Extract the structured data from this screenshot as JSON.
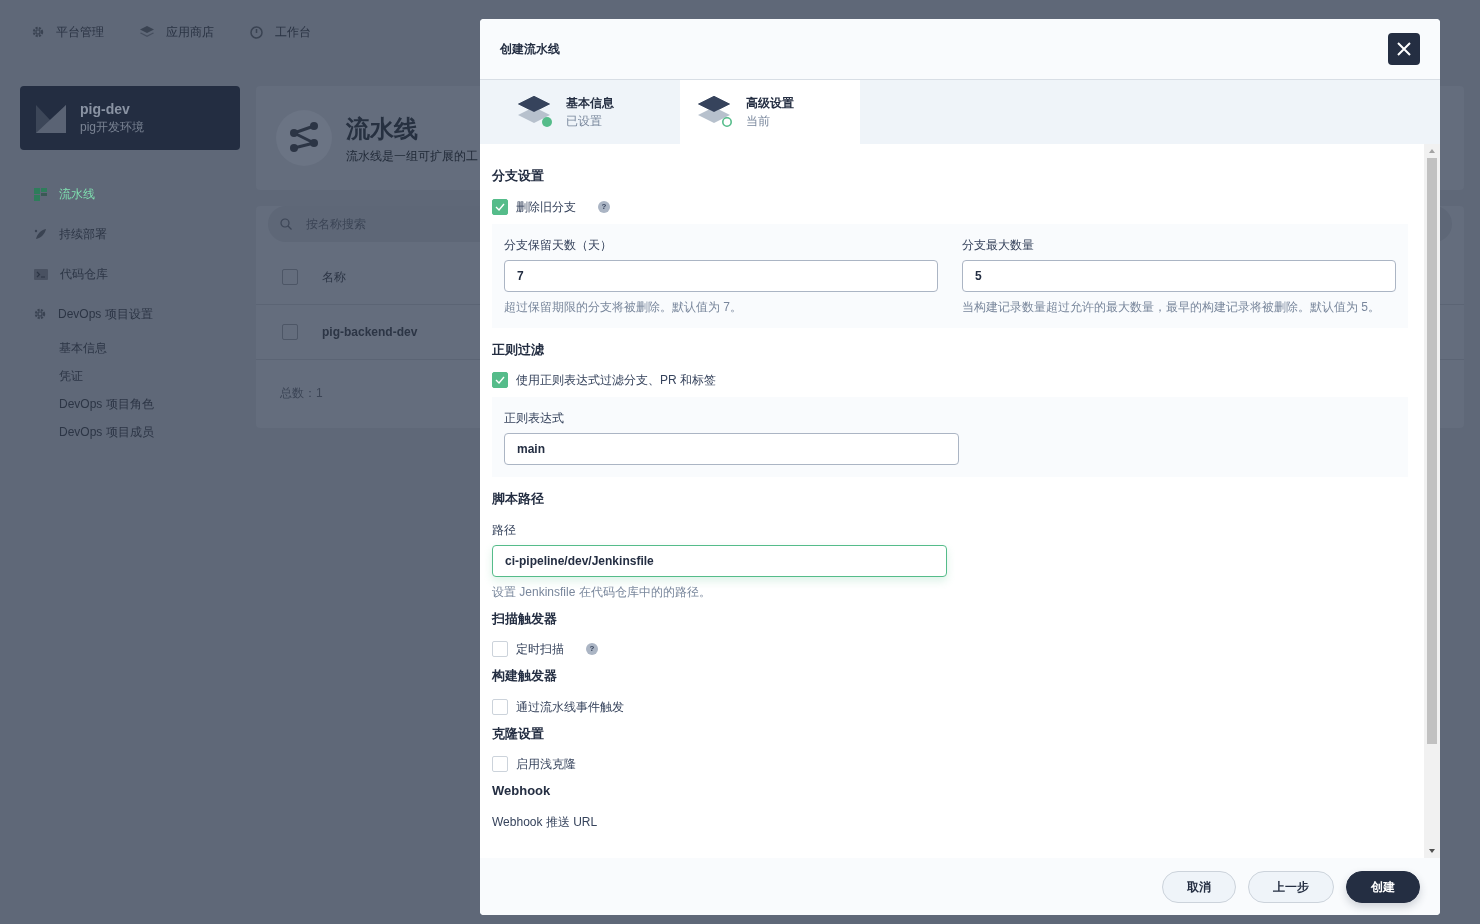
{
  "top_nav": [
    {
      "label": "平台管理"
    },
    {
      "label": "应用商店"
    },
    {
      "label": "工作台"
    }
  ],
  "project": {
    "name": "pig-dev",
    "description": "pig开发环境"
  },
  "sidebar": {
    "items": [
      {
        "label": "流水线",
        "selected": true
      },
      {
        "label": "持续部署",
        "selected": false
      },
      {
        "label": "代码仓库",
        "selected": false
      },
      {
        "label": "DevOps 项目设置",
        "selected": false,
        "children": [
          {
            "label": "基本信息",
            "selected": false
          },
          {
            "label": "凭证",
            "selected": false
          },
          {
            "label": "DevOps 项目角色",
            "selected": false
          },
          {
            "label": "DevOps 项目成员",
            "selected": false
          }
        ]
      }
    ]
  },
  "page_header": {
    "title": "流水线",
    "description": "流水线是一组可扩展的工"
  },
  "table": {
    "search_placeholder": "按名称搜索",
    "columns": [
      "名称"
    ],
    "rows": [
      {
        "name": "pig-backend-dev",
        "checked": false
      }
    ],
    "header_checked": false,
    "total": "总数：1"
  },
  "modal": {
    "title": "创建流水线",
    "steps": [
      {
        "title": "基本信息",
        "status_text": "已设置",
        "done": true,
        "selected": false
      },
      {
        "title": "高级设置",
        "status_text": "当前",
        "done": false,
        "selected": true
      }
    ],
    "sections": [
      {
        "title": "分支设置",
        "items": [
          {
            "kind": "checkbox",
            "label": "删除旧分支",
            "checked": true,
            "help": "?"
          },
          {
            "kind": "panel",
            "fields": [
              {
                "label": "分支保留天数（天）",
                "value": "7",
                "hint": "超过保留期限的分支将被删除。默认值为 7。"
              },
              {
                "label": "分支最大数量",
                "value": "5",
                "hint": "当构建记录数量超过允许的最大数量，最早的构建记录将被删除。默认值为 5。"
              }
            ]
          }
        ]
      },
      {
        "title": "正则过滤",
        "items": [
          {
            "kind": "checkbox",
            "label": "使用正则表达式过滤分支、PR 和标签",
            "checked": true
          },
          {
            "kind": "panel",
            "half": true,
            "fields": [
              {
                "label": "正则表达式",
                "value": "main"
              }
            ]
          }
        ]
      },
      {
        "title": "脚本路径",
        "items": [
          {
            "kind": "field",
            "label": "路径",
            "value": "ci-pipeline/dev/Jenkinsfile",
            "hint": "设置 Jenkinsfile 在代码仓库中的的路径。",
            "focused": true
          }
        ]
      },
      {
        "title": "扫描触发器",
        "items": [
          {
            "kind": "checkbox",
            "label": "定时扫描",
            "checked": false,
            "help": "?"
          }
        ]
      },
      {
        "title": "构建触发器",
        "items": [
          {
            "kind": "checkbox",
            "label": "通过流水线事件触发",
            "checked": false
          }
        ]
      },
      {
        "title": "克隆设置",
        "items": [
          {
            "kind": "checkbox",
            "label": "启用浅克隆",
            "checked": false
          }
        ]
      },
      {
        "title": "Webhook",
        "items": [
          {
            "kind": "label",
            "text": "Webhook 推送 URL"
          }
        ]
      }
    ],
    "buttons": [
      {
        "label": "取消",
        "kind": "default"
      },
      {
        "label": "上一步",
        "kind": "default"
      },
      {
        "label": "创建",
        "kind": "primary"
      }
    ]
  }
}
